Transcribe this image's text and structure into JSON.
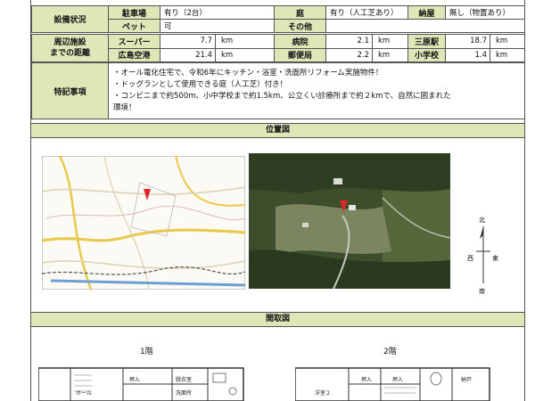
{
  "equipment": {
    "section_label": "設備状況",
    "parking_label": "駐車場",
    "parking_value": "有り（2台）",
    "garden_label": "庭",
    "garden_value": "有り（人工芝あり）",
    "shed_label": "納屋",
    "shed_value": "無し（物置あり）",
    "pet_label": "ペット",
    "pet_value": "可",
    "other_label": "その他",
    "other_value": ""
  },
  "distances": {
    "section_label_1": "周辺施設",
    "section_label_2": "までの距離",
    "rows": [
      [
        {
          "name": "スーパー",
          "value": "7.7",
          "unit": "km"
        },
        {
          "name": "病院",
          "value": "2.1",
          "unit": "km"
        },
        {
          "name": "三原駅",
          "value": "18.7",
          "unit": "km"
        }
      ],
      [
        {
          "name": "広島空港",
          "value": "21.4",
          "unit": "km"
        },
        {
          "name": "郵便局",
          "value": "2.2",
          "unit": "km"
        },
        {
          "name": "小学校",
          "value": "1.4",
          "unit": "km"
        }
      ]
    ]
  },
  "notes": {
    "label": "特記事項",
    "lines": [
      "・オール電化住宅で、令和6年にキッチン・浴室・洗面所リフォーム実施物件！",
      "・ドッグランとして使用できる庭（人工芝）付き！",
      "・コンビニまで約500m、小中学校まで約1.5km、公立くい診療所まで約２kmで、自然に囲まれた",
      "環境！"
    ]
  },
  "location": {
    "title": "位置図",
    "compass": {
      "north": "北",
      "west": "西",
      "east": "東",
      "south": "南"
    }
  },
  "floorplan": {
    "title": "間取図",
    "floor1": "1階",
    "floor2": "2階",
    "rooms1": [
      "ホール",
      "押入",
      "脱衣室",
      "洗面所"
    ],
    "rooms2": [
      "洋室２",
      "押入",
      "押入",
      "納戸"
    ]
  },
  "colors": {
    "header_bg": "#dfe7b8",
    "border": "#555555",
    "marker": "#e0242a"
  }
}
